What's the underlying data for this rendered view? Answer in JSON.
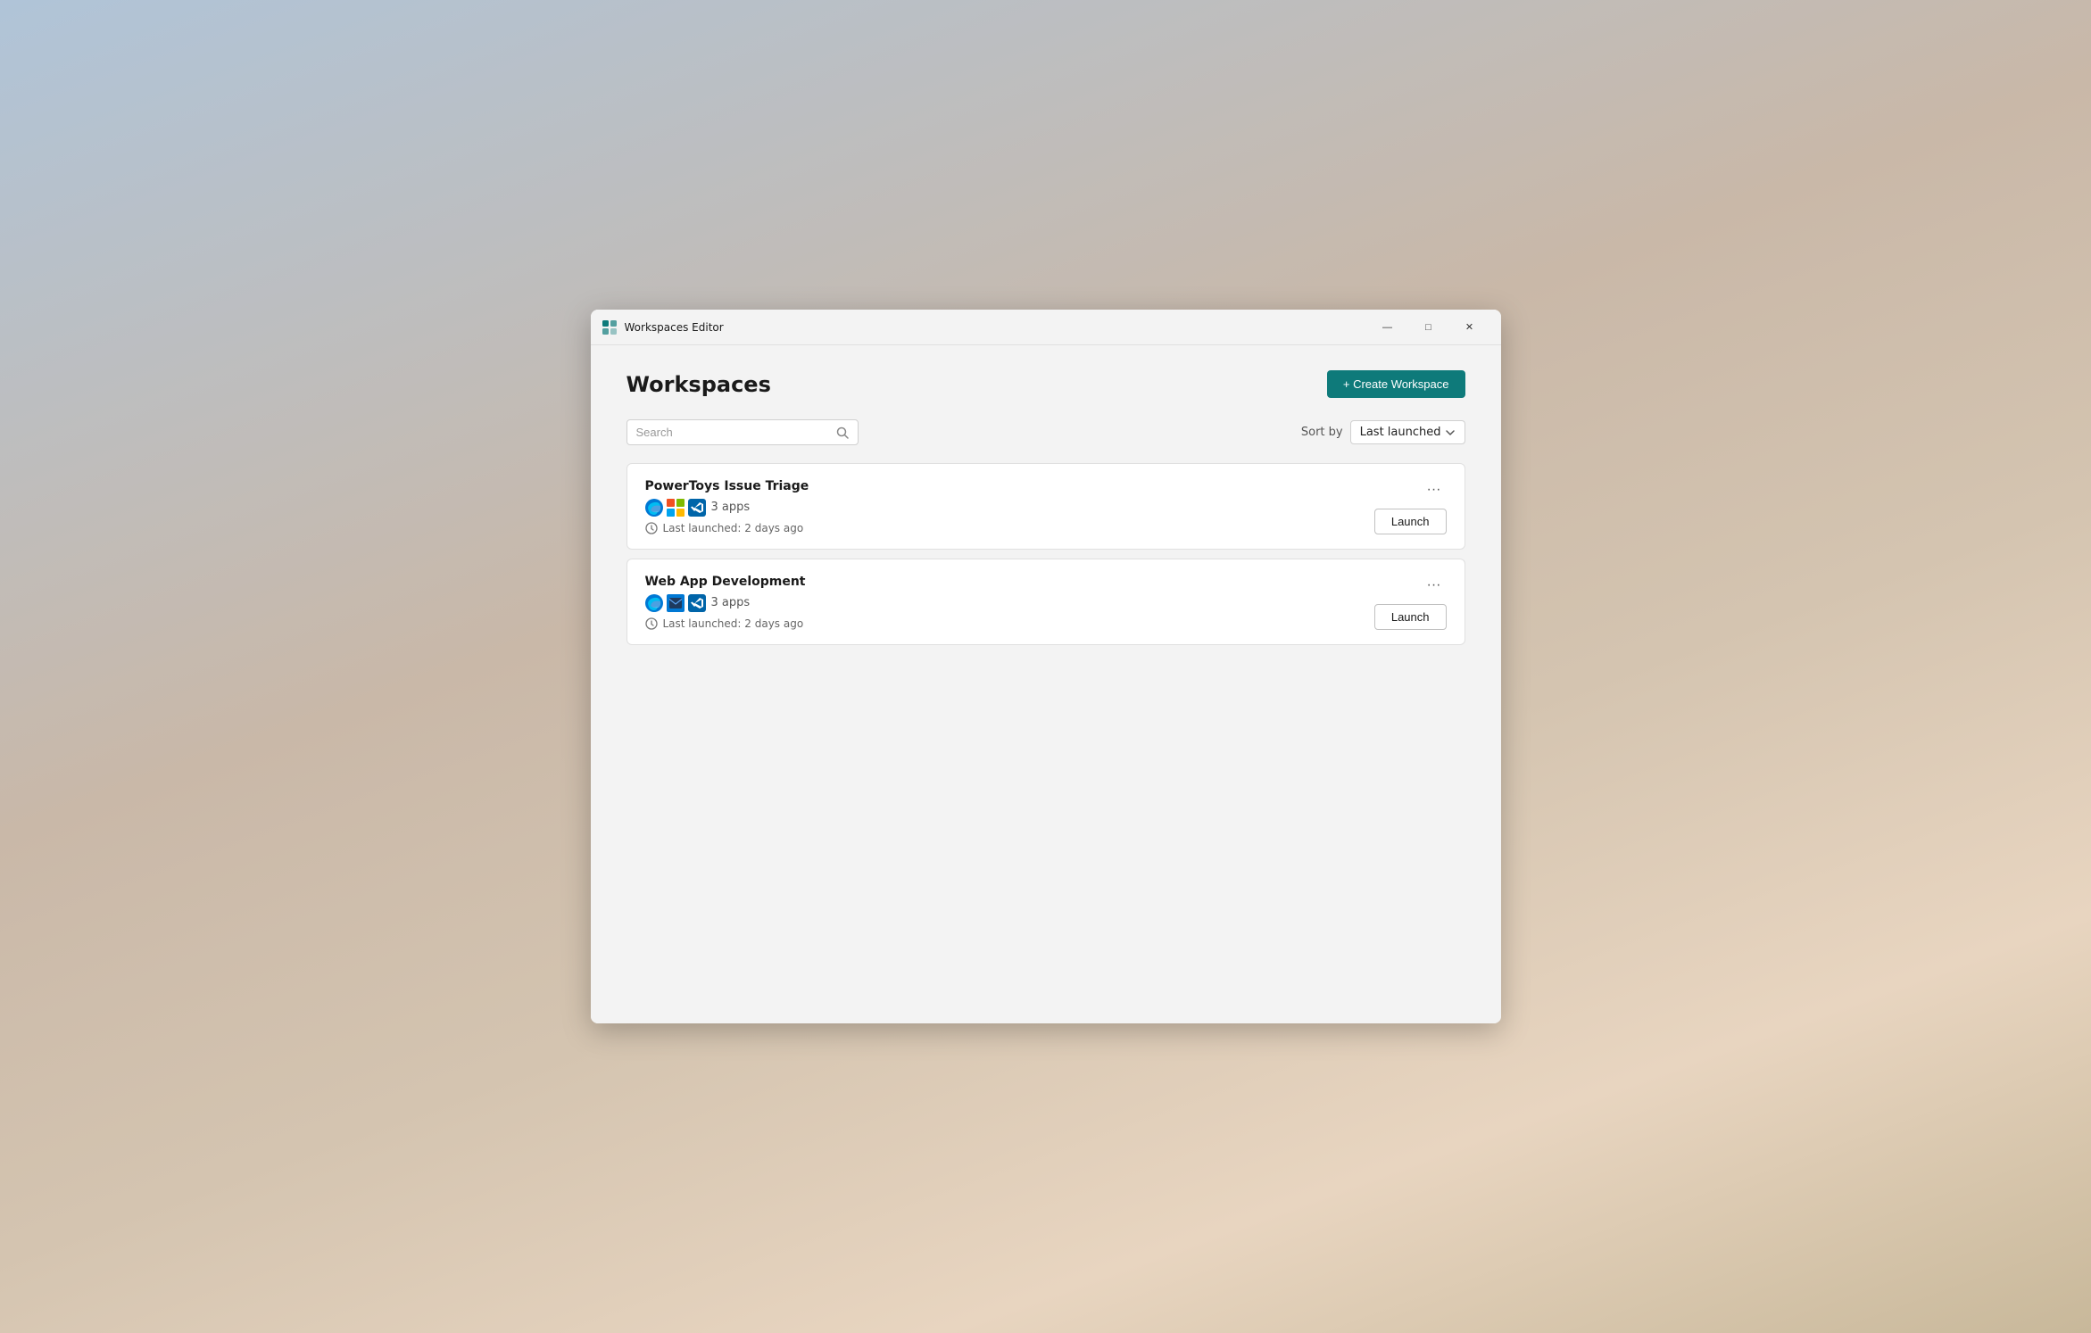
{
  "window": {
    "title": "Workspaces Editor",
    "controls": {
      "minimize": "—",
      "maximize": "□",
      "close": "✕"
    }
  },
  "page": {
    "title": "Workspaces",
    "create_button": "+ Create Workspace",
    "search_placeholder": "Search",
    "sort_label": "Sort by",
    "sort_value": "Last launched"
  },
  "workspaces": [
    {
      "name": "PowerToys Issue Triage",
      "apps_count": "3 apps",
      "last_launched": "Last launched: 2 days ago",
      "launch_label": "Launch"
    },
    {
      "name": "Web App Development",
      "apps_count": "3 apps",
      "last_launched": "Last launched: 2 days ago",
      "launch_label": "Launch"
    }
  ]
}
